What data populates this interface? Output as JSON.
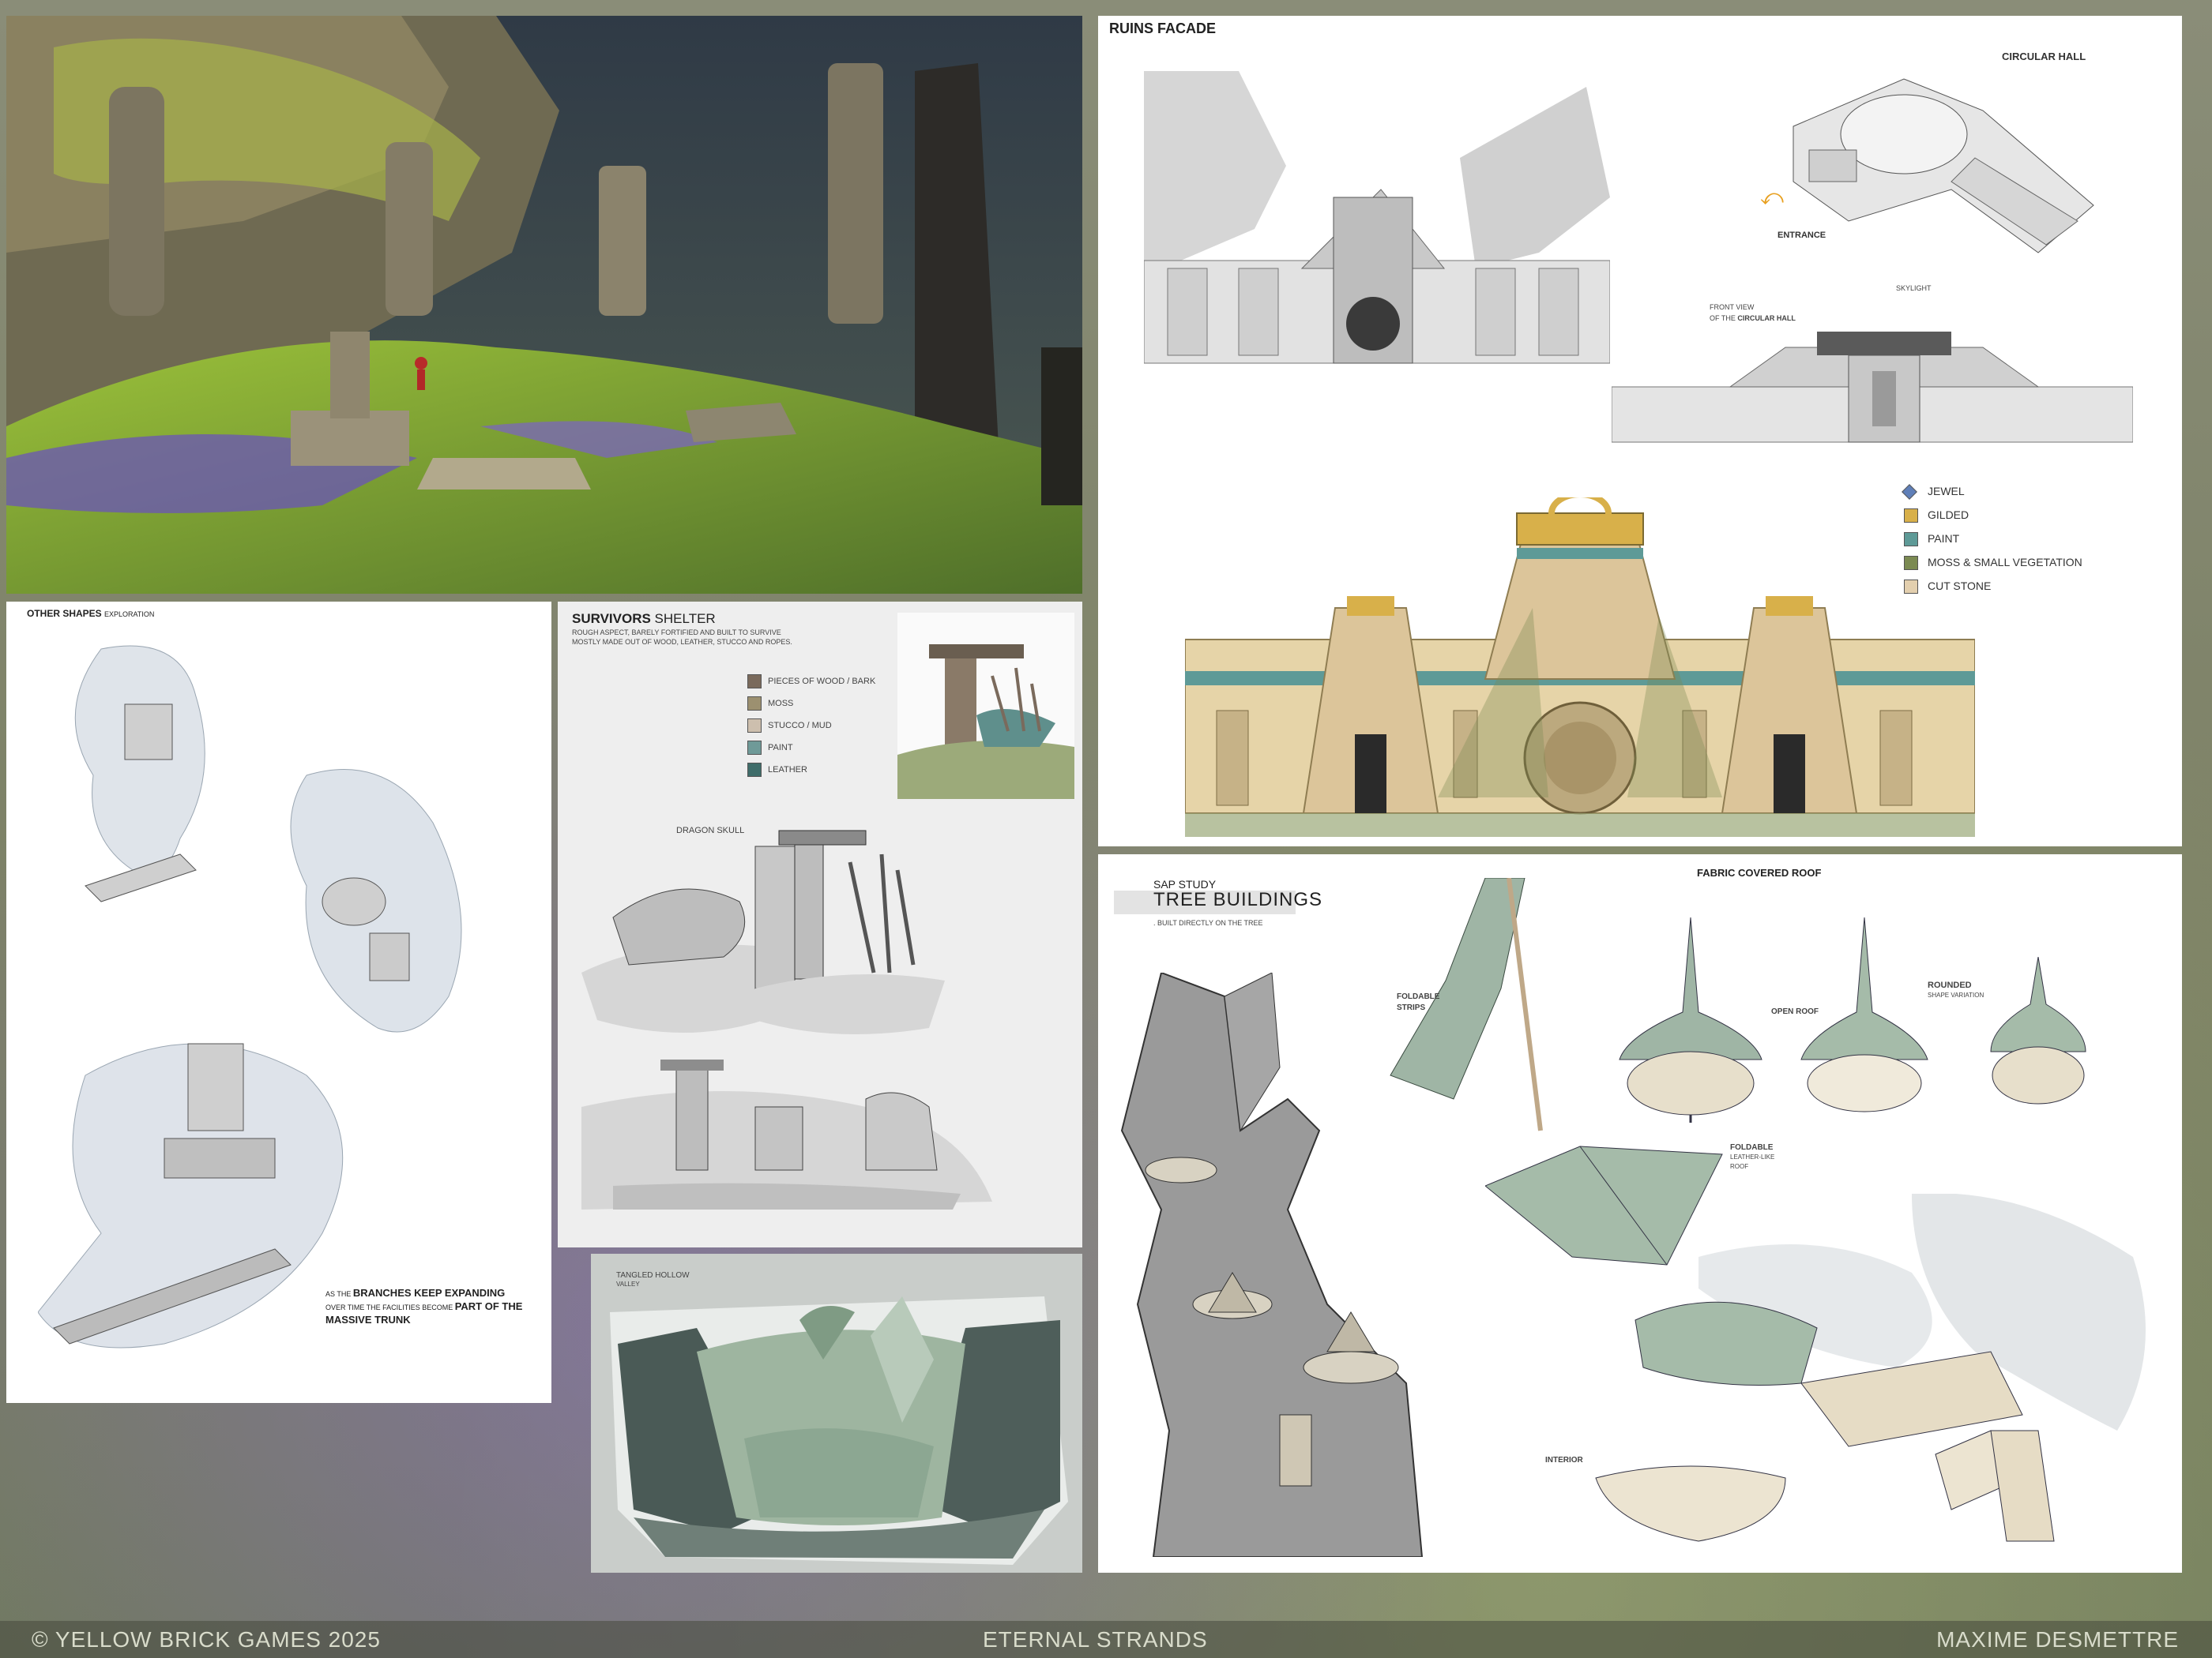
{
  "footer": {
    "copyright": "© YELLOW BRICK GAMES 2025",
    "project": "ETERNAL STRANDS",
    "artist": "MAXIME DESMETTRE"
  },
  "ruins_facade": {
    "title": "RUINS FACADE",
    "labels": {
      "circular_hall": "CIRCULAR HALL",
      "entrance": "ENTRANCE",
      "skylight": "SKYLIGHT",
      "front_view_1": "FRONT VIEW",
      "front_view_2a": "OF THE ",
      "front_view_2b": "CIRCULAR HALL"
    },
    "legend": [
      {
        "label": "JEWEL",
        "color": "#5f7fb8"
      },
      {
        "label": "GILDED",
        "color": "#d8b04a"
      },
      {
        "label": "PAINT",
        "color": "#5e9a97"
      },
      {
        "label": "MOSS & SMALL VEGETATION",
        "color": "#7b8a52"
      },
      {
        "label": "CUT STONE",
        "color": "#e3cfae"
      }
    ]
  },
  "other_shapes": {
    "title": "OTHER SHAPES",
    "subtitle": "EXPLORATION",
    "note_1a": "AS THE ",
    "note_1b": "BRANCHES KEEP EXPANDING",
    "note_2a": "OVER TIME THE FACILITIES BECOME ",
    "note_2b": "PART OF THE",
    "note_3": "MASSIVE TRUNK"
  },
  "survivors_shelter": {
    "title_a": "SURVIVORS",
    "title_b": " SHELTER",
    "desc_1": "ROUGH ASPECT, BARELY FORTIFIED AND BUILT TO SURVIVE",
    "desc_2": "MOSTLY MADE OUT OF WOOD, LEATHER, STUCCO AND ROPES.",
    "legend": [
      {
        "label": "PIECES OF WOOD / BARK",
        "color": "#7a6a5c"
      },
      {
        "label": "MOSS",
        "color": "#9c9070"
      },
      {
        "label": "STUCCO / MUD",
        "color": "#cdbfae"
      },
      {
        "label": "PAINT",
        "color": "#6f9a98"
      },
      {
        "label": "LEATHER",
        "color": "#3f6d6a"
      }
    ],
    "dragon_skull": "DRAGON SKULL"
  },
  "tangled_hollow": {
    "title": "TANGLED HOLLOW",
    "subtitle": "VALLEY"
  },
  "tree_buildings": {
    "kicker": "SAP STUDY",
    "title": "TREE BUILDINGS",
    "subtitle": ". BUILT DIRECTLY ON THE TREE",
    "fabric_roof": "FABRIC COVERED ROOF",
    "foldable_strips_1": "FOLDABLE",
    "foldable_strips_2": "STRIPS",
    "open_roof": "OPEN ROOF",
    "rounded": "ROUNDED",
    "shape_variation": "SHAPE VARIATION",
    "foldable_leather_1": "FOLDABLE",
    "foldable_leather_2": "LEATHER-LIKE",
    "foldable_leather_3": "ROOF",
    "interior": "INTERIOR"
  }
}
